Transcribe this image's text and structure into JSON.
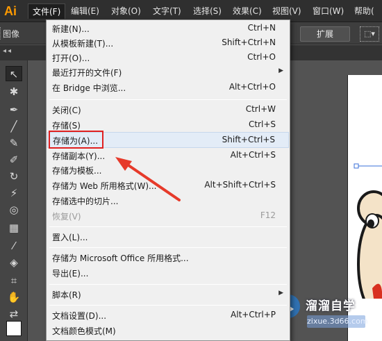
{
  "app": {
    "logo": "Ai"
  },
  "menubar": {
    "items": [
      {
        "label": "文件(F)"
      },
      {
        "label": "编辑(E)"
      },
      {
        "label": "对象(O)"
      },
      {
        "label": "文字(T)"
      },
      {
        "label": "选择(S)"
      },
      {
        "label": "效果(C)"
      },
      {
        "label": "视图(V)"
      },
      {
        "label": "窗口(W)"
      },
      {
        "label": "帮助("
      }
    ]
  },
  "control_bar": {
    "label": "图像",
    "expand_label": "扩展",
    "transform_icon": "transform-icon"
  },
  "file_menu": {
    "items": [
      {
        "label": "新建(N)...",
        "shortcut": "Ctrl+N"
      },
      {
        "label": "从模板新建(T)...",
        "shortcut": "Shift+Ctrl+N"
      },
      {
        "label": "打开(O)...",
        "shortcut": "Ctrl+O"
      },
      {
        "label": "最近打开的文件(F)",
        "shortcut": "",
        "submenu": "▶"
      },
      {
        "label": "在 Bridge 中浏览...",
        "shortcut": "Alt+Ctrl+O"
      },
      {
        "label": "关闭(C)",
        "shortcut": "Ctrl+W"
      },
      {
        "label": "存储(S)",
        "shortcut": "Ctrl+S"
      },
      {
        "label": "存储为(A)...",
        "shortcut": "Shift+Ctrl+S"
      },
      {
        "label": "存储副本(Y)...",
        "shortcut": "Alt+Ctrl+S"
      },
      {
        "label": "存储为模板...",
        "shortcut": ""
      },
      {
        "label": "存储为 Web 所用格式(W)...",
        "shortcut": "Alt+Shift+Ctrl+S"
      },
      {
        "label": "存储选中的切片...",
        "shortcut": ""
      },
      {
        "label": "恢复(V)",
        "shortcut": "F12"
      },
      {
        "label": "置入(L)...",
        "shortcut": ""
      },
      {
        "label": "存储为 Microsoft Office 所用格式...",
        "shortcut": ""
      },
      {
        "label": "导出(E)...",
        "shortcut": ""
      },
      {
        "label": "脚本(R)",
        "shortcut": "",
        "submenu": "▶"
      },
      {
        "label": "文档设置(D)...",
        "shortcut": "Alt+Ctrl+P"
      },
      {
        "label": "文档颜色模式(M)",
        "shortcut": ""
      }
    ]
  },
  "watermark": {
    "title": "溜溜自学",
    "url": "zixue.3d66.com"
  },
  "colors": {
    "highlight_box": "#e02020",
    "menu_bg": "#f0f0f0",
    "logo": "#ff9a00"
  }
}
